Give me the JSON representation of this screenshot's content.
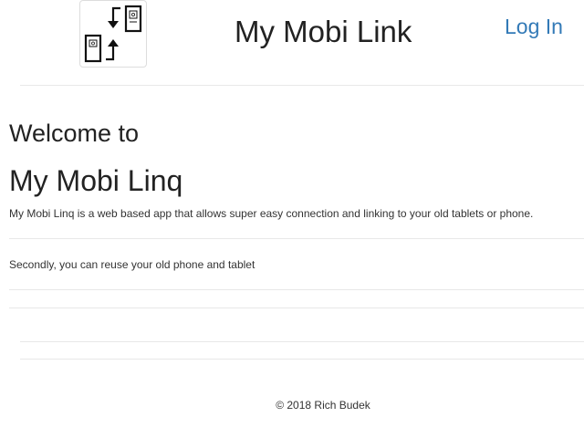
{
  "header": {
    "title": "My Mobi Link",
    "login_label": "Log In",
    "logo_icon": "devices-sync-icon"
  },
  "main": {
    "welcome": "Welcome to",
    "app_name": "My Mobi Linq",
    "intro": "My Mobi Linq is a web based app that allows super easy connection and linking to your old tablets or phone.",
    "secondly": "Secondly, you can reuse your old phone and tablet"
  },
  "footer": {
    "copyright": "© 2018 Rich Budek"
  },
  "colors": {
    "link": "#337ab7",
    "rule": "#e8e8e8",
    "text": "#333333"
  }
}
